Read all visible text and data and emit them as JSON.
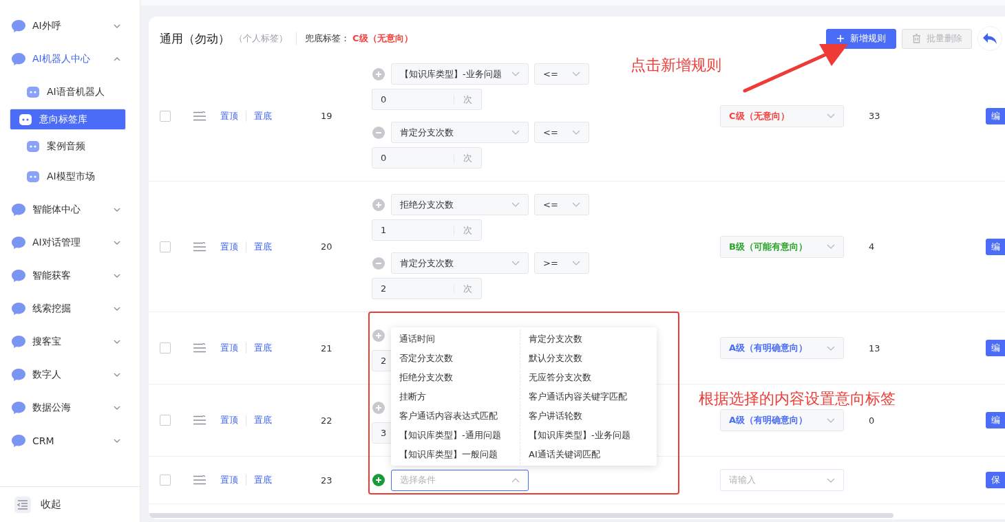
{
  "sidebar": {
    "items": [
      {
        "label": "AI外呼",
        "expanded": false
      },
      {
        "label": "AI机器人中心",
        "expanded": true,
        "children": [
          {
            "label": "AI语音机器人",
            "selected": false
          },
          {
            "label": "意向标签库",
            "selected": true
          },
          {
            "label": "案例音频",
            "selected": false
          },
          {
            "label": "AI模型市场",
            "selected": false
          }
        ]
      },
      {
        "label": "智能体中心",
        "expanded": false
      },
      {
        "label": "AI对话管理",
        "expanded": false
      },
      {
        "label": "智能获客",
        "expanded": false
      },
      {
        "label": "线索挖掘",
        "expanded": false
      },
      {
        "label": "搜客宝",
        "expanded": false
      },
      {
        "label": "数字人",
        "expanded": false
      },
      {
        "label": "数据公海",
        "expanded": false
      },
      {
        "label": "CRM",
        "expanded": false
      }
    ],
    "collapse_label": "收起"
  },
  "header": {
    "title": "通用（勿动）",
    "subtitle": "（个人标签）",
    "fallback_label": "兜底标签：",
    "fallback_tag": {
      "text": "C级（无意向）",
      "color": "#f5403c"
    },
    "buttons": [
      {
        "label": "新增规则",
        "kind": "add",
        "disabled": false
      },
      {
        "label": "批量删除",
        "kind": "delete",
        "disabled": true
      }
    ]
  },
  "rows": [
    {
      "checked": false,
      "pin_top": "置顶",
      "pin_bottom": "置底",
      "index": "19",
      "conditions": [
        {
          "kind": "plus",
          "field": "【知识库类型】-业务问题",
          "operator": "<=",
          "value": "0",
          "unit": "次"
        },
        {
          "kind": "minus",
          "field": "肯定分支次数",
          "operator": "<=",
          "value": "0",
          "unit": "次"
        }
      ],
      "tag": {
        "text": "C级（无意向）",
        "color": "#f5403c"
      },
      "count": "33",
      "action": "编"
    },
    {
      "checked": false,
      "pin_top": "置顶",
      "pin_bottom": "置底",
      "index": "20",
      "conditions": [
        {
          "kind": "plus",
          "field": "拒绝分支次数",
          "operator": "<=",
          "value": "1",
          "unit": "次"
        },
        {
          "kind": "minus",
          "field": "肯定分支次数",
          "operator": ">=",
          "value": "2",
          "unit": "次"
        }
      ],
      "tag": {
        "text": "B级（可能有意向）",
        "color": "#2aa52a"
      },
      "count": "4",
      "action": "编"
    },
    {
      "checked": false,
      "pin_top": "置顶",
      "pin_bottom": "置底",
      "index": "21",
      "conditions": [
        {
          "kind": "plus",
          "value": "2"
        }
      ],
      "tag": {
        "text": "A级（有明确意向）",
        "color": "#4a6cf7"
      },
      "count": "13",
      "action": "编"
    },
    {
      "checked": false,
      "pin_top": "置顶",
      "pin_bottom": "置底",
      "index": "22",
      "conditions": [
        {
          "kind": "plus",
          "value": "3"
        }
      ],
      "tag": {
        "text": "A级（有明确意向）",
        "color": "#4a6cf7"
      },
      "count": "0",
      "action": "编"
    },
    {
      "checked": false,
      "pin_top": "置顶",
      "pin_bottom": "置底",
      "index": "23",
      "conditions": [
        {
          "kind": "add",
          "open": true,
          "placeholder": "选择条件",
          "options": [
            [
              "通话时间",
              "否定分支次数",
              "拒绝分支次数",
              "挂断方",
              "客户通话内容表达式匹配",
              "【知识库类型】-通用问题",
              "【知识库类型】一般问题"
            ],
            [
              "肯定分支次数",
              "默认分支次数",
              "无应答分支次数",
              "客户通话内容关键字匹配",
              "客户讲话轮数",
              "【知识库类型】-业务问题",
              "AI通话关键词匹配"
            ]
          ]
        }
      ],
      "tag": {
        "placeholder": "请输入"
      },
      "action": "保"
    }
  ],
  "annotations": [
    {
      "kind": "text",
      "text": "点击新增规则"
    },
    {
      "kind": "arrow"
    },
    {
      "kind": "frame"
    },
    {
      "kind": "text",
      "text": "根据选择的内容设置意向标签"
    }
  ]
}
